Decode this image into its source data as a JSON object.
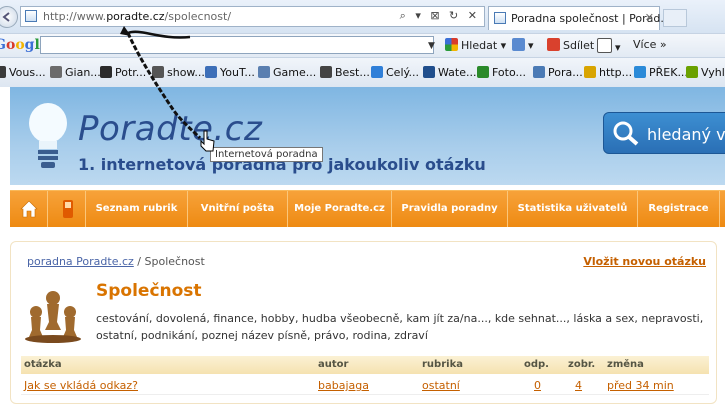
{
  "browser": {
    "address_prefix": "http://www.",
    "address_domain": "poradte.cz",
    "address_path": "/spolecnost/",
    "address_tools": "⌕ ▾ ⊠ ↻ ✕",
    "tab_title": "Poradna společnost | Porad...",
    "tab_close": "✕"
  },
  "google_bar": {
    "logo": "Google",
    "search_value": "",
    "hledat_label": "Hledat ▾",
    "sdilet_label": "Sdílet",
    "vice_label": "Více »"
  },
  "favorites": [
    {
      "label": "Vous...",
      "color": "#3a3a3a"
    },
    {
      "label": "Gian...",
      "color": "#6b6b6b"
    },
    {
      "label": "Potr...",
      "color": "#2b2b2b"
    },
    {
      "label": "show...",
      "color": "#555555"
    },
    {
      "label": "YouT...",
      "color": "#3d6fb8"
    },
    {
      "label": "Game...",
      "color": "#5a7fb0"
    },
    {
      "label": "Best...",
      "color": "#444444"
    },
    {
      "label": "Celý...",
      "color": "#2f7fd8"
    },
    {
      "label": "Wate...",
      "color": "#1f4e8c"
    },
    {
      "label": "Foto...",
      "color": "#2a8a2a"
    },
    {
      "label": "Pora...",
      "color": "#4a7ab5"
    },
    {
      "label": "http...",
      "color": "#d8a400"
    },
    {
      "label": "PŘEK...",
      "color": "#2a8ad8"
    },
    {
      "label": "Vyhl",
      "color": "#6aa100"
    }
  ],
  "site": {
    "logo": "Poradte.cz",
    "tagline": "1. internetová poradna pro jakoukoliv otázku",
    "tooltip": "Internetová poradna",
    "search_label": "hledaný výr"
  },
  "menu": [
    {
      "label": "Seznam rubrik"
    },
    {
      "label": "Vnitřní pošta"
    },
    {
      "label": "Moje Poradte.cz"
    },
    {
      "label": "Pravidla poradny"
    },
    {
      "label": "Statistika uživatelů"
    },
    {
      "label": "Registrace"
    }
  ],
  "content": {
    "breadcrumb_link": "poradna Poradte.cz",
    "breadcrumb_sep": " / ",
    "breadcrumb_current": "Společnost",
    "new_question": "Vložit novou otázku",
    "section_title": "Společnost",
    "description": "cestování, dovolená, finance, hobby, hudba všeobecně, kam jít za/na..., kde sehnat..., láska a sex, nepravosti, ostatní, podnikání, poznej název písně, právo, rodina, zdraví",
    "table_headers": {
      "question": "otázka",
      "author": "autor",
      "category": "rubrika",
      "answers": "odp.",
      "views": "zobr.",
      "change": "změna"
    },
    "rows": [
      {
        "question": "Jak se vkládá odkaz?",
        "author": "babajaga",
        "category": "ostatní",
        "answers": "0",
        "views": "4",
        "change": "před 34 min"
      }
    ]
  },
  "colors": {
    "accent_orange": "#ee8a12",
    "header_blue": "#7fb6e2",
    "logo_blue": "#2a4d8d",
    "link_orange": "#c56000"
  }
}
